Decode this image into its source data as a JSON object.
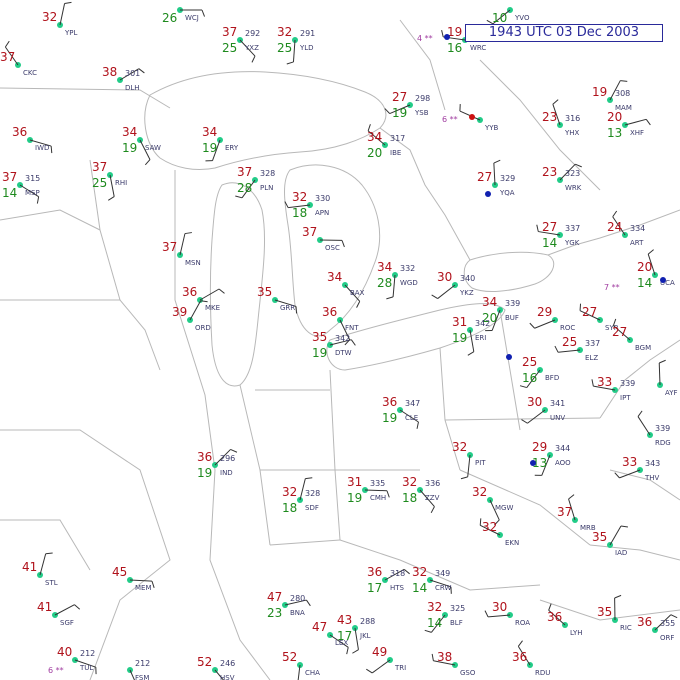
{
  "header": {
    "timestamp": "1943 UTC 03 Dec 2003"
  },
  "colors": {
    "temperature": "#b0121b",
    "dewpoint": "#1e8a1e",
    "station": "#3a3a6a",
    "station_dot": "#22cc88",
    "title_box": "#2a2a9a"
  },
  "stations": [
    {
      "id": "WCJ",
      "t": "",
      "d": "26",
      "p": ""
    },
    {
      "id": "YXZ",
      "t": "37",
      "d": "25",
      "p": "292"
    },
    {
      "id": "YLD",
      "t": "32",
      "d": "25",
      "p": "291"
    },
    {
      "id": "YVO",
      "t": "",
      "d": "10",
      "p": ""
    },
    {
      "id": "WRC",
      "t": "19",
      "d": "16",
      "p": "292"
    },
    {
      "id": "CKC",
      "t": "37",
      "d": "",
      "p": ""
    },
    {
      "id": "YPL",
      "t": "32",
      "d": "",
      "p": ""
    },
    {
      "id": "DLH",
      "t": "38",
      "d": "",
      "p": "301"
    },
    {
      "id": "IWD",
      "t": "36",
      "d": "",
      "p": ""
    },
    {
      "id": "SAW",
      "t": "34",
      "d": "19",
      "p": ""
    },
    {
      "id": "ERY",
      "t": "34",
      "d": "19",
      "p": ""
    },
    {
      "id": "YSB",
      "t": "27",
      "d": "19",
      "p": "298"
    },
    {
      "id": "YYB",
      "t": "",
      "d": "",
      "p": ""
    },
    {
      "id": "YHX",
      "t": "23",
      "d": "",
      "p": "316"
    },
    {
      "id": "MAM",
      "t": "19",
      "d": "",
      "p": "308"
    },
    {
      "id": "XHF",
      "t": "20",
      "d": "13",
      "p": ""
    },
    {
      "id": "MSP",
      "t": "37",
      "d": "14",
      "p": "315"
    },
    {
      "id": "RHI",
      "t": "37",
      "d": "25",
      "p": ""
    },
    {
      "id": "PLN",
      "t": "37",
      "d": "28",
      "p": "328"
    },
    {
      "id": "APN",
      "t": "32",
      "d": "18",
      "p": "330"
    },
    {
      "id": "IBE",
      "t": "34",
      "d": "20",
      "p": "317"
    },
    {
      "id": "YQA",
      "t": "27",
      "d": "",
      "p": "329"
    },
    {
      "id": "WRK",
      "t": "23",
      "d": "",
      "p": "323"
    },
    {
      "id": "OSC",
      "t": "37",
      "d": "",
      "p": ""
    },
    {
      "id": "BAX",
      "t": "34",
      "d": "",
      "p": ""
    },
    {
      "id": "WGD",
      "t": "34",
      "d": "28",
      "p": "332"
    },
    {
      "id": "YKZ",
      "t": "30",
      "d": "",
      "p": "340"
    },
    {
      "id": "YGK",
      "t": "27",
      "d": "14",
      "p": "337"
    },
    {
      "id": "ART",
      "t": "24",
      "d": "",
      "p": "334"
    },
    {
      "id": "MSN",
      "t": "37",
      "d": "",
      "p": ""
    },
    {
      "id": "MKE",
      "t": "36",
      "d": "",
      "p": ""
    },
    {
      "id": "GRR",
      "t": "35",
      "d": "",
      "p": ""
    },
    {
      "id": "FNT",
      "t": "36",
      "d": "",
      "p": ""
    },
    {
      "id": "BUF",
      "t": "34",
      "d": "20",
      "p": "339"
    },
    {
      "id": "ROC",
      "t": "29",
      "d": "",
      "p": ""
    },
    {
      "id": "SYR",
      "t": "27",
      "d": "",
      "p": ""
    },
    {
      "id": "UCA",
      "t": "20",
      "d": "14",
      "p": ""
    },
    {
      "id": "ORD",
      "t": "39",
      "d": "",
      "p": ""
    },
    {
      "id": "DTW",
      "t": "35",
      "d": "19",
      "p": "342"
    },
    {
      "id": "CLE",
      "t": "36",
      "d": "19",
      "p": "347"
    },
    {
      "id": "ERI",
      "t": "31",
      "d": "19",
      "p": "342"
    },
    {
      "id": "BFD",
      "t": "25",
      "d": "16",
      "p": ""
    },
    {
      "id": "ELZ",
      "t": "25",
      "d": "",
      "p": "337"
    },
    {
      "id": "BGM",
      "t": "27",
      "d": "",
      "p": ""
    },
    {
      "id": "AYF",
      "t": "",
      "d": "",
      "p": ""
    },
    {
      "id": "IND",
      "t": "36",
      "d": "19",
      "p": "296"
    },
    {
      "id": "CMH",
      "t": "31",
      "d": "19",
      "p": "335"
    },
    {
      "id": "ZZV",
      "t": "32",
      "d": "18",
      "p": "336"
    },
    {
      "id": "PIT",
      "t": "32",
      "d": "",
      "p": ""
    },
    {
      "id": "UNV",
      "t": "30",
      "d": "",
      "p": "341"
    },
    {
      "id": "IPT",
      "t": "33",
      "d": "",
      "p": "339"
    },
    {
      "id": "RDG",
      "t": "",
      "d": "",
      "p": "339"
    },
    {
      "id": "SDF",
      "t": "32",
      "d": "18",
      "p": "328"
    },
    {
      "id": "HTS",
      "t": "36",
      "d": "17",
      "p": "318"
    },
    {
      "id": "CRW",
      "t": "32",
      "d": "14",
      "p": "349"
    },
    {
      "id": "MGW",
      "t": "32",
      "d": "",
      "p": ""
    },
    {
      "id": "AOO",
      "t": "29",
      "d": "13",
      "p": "344"
    },
    {
      "id": "THV",
      "t": "33",
      "d": "",
      "p": "343"
    },
    {
      "id": "EKN",
      "t": "32",
      "d": "",
      "p": ""
    },
    {
      "id": "MRB",
      "t": "37",
      "d": "",
      "p": ""
    },
    {
      "id": "IAD",
      "t": "35",
      "d": "",
      "p": ""
    },
    {
      "id": "BNA",
      "t": "47",
      "d": "23",
      "p": "280"
    },
    {
      "id": "LEX",
      "t": "47",
      "d": "",
      "p": ""
    },
    {
      "id": "JKL",
      "t": "43",
      "d": "17",
      "p": "288"
    },
    {
      "id": "BLF",
      "t": "32",
      "d": "14",
      "p": "325"
    },
    {
      "id": "ROA",
      "t": "30",
      "d": "",
      "p": ""
    },
    {
      "id": "LYH",
      "t": "36",
      "d": "",
      "p": ""
    },
    {
      "id": "RIC",
      "t": "35",
      "d": "",
      "p": ""
    },
    {
      "id": "ORF",
      "t": "36",
      "d": "",
      "p": "355"
    },
    {
      "id": "MEM",
      "t": "45",
      "d": "",
      "p": ""
    },
    {
      "id": "HSV",
      "t": "52",
      "d": "",
      "p": "246"
    },
    {
      "id": "CHA",
      "t": "52",
      "d": "",
      "p": ""
    },
    {
      "id": "TRI",
      "t": "49",
      "d": "",
      "p": ""
    },
    {
      "id": "GSO",
      "t": "38",
      "d": "",
      "p": ""
    },
    {
      "id": "RDU",
      "t": "36",
      "d": "",
      "p": ""
    },
    {
      "id": "STL",
      "t": "41",
      "d": "",
      "p": ""
    },
    {
      "id": "SGF",
      "t": "41",
      "d": "",
      "p": ""
    },
    {
      "id": "TUL",
      "t": "40",
      "d": "",
      "p": "212"
    },
    {
      "id": "FSM",
      "t": "",
      "d": "",
      "p": "212"
    }
  ]
}
